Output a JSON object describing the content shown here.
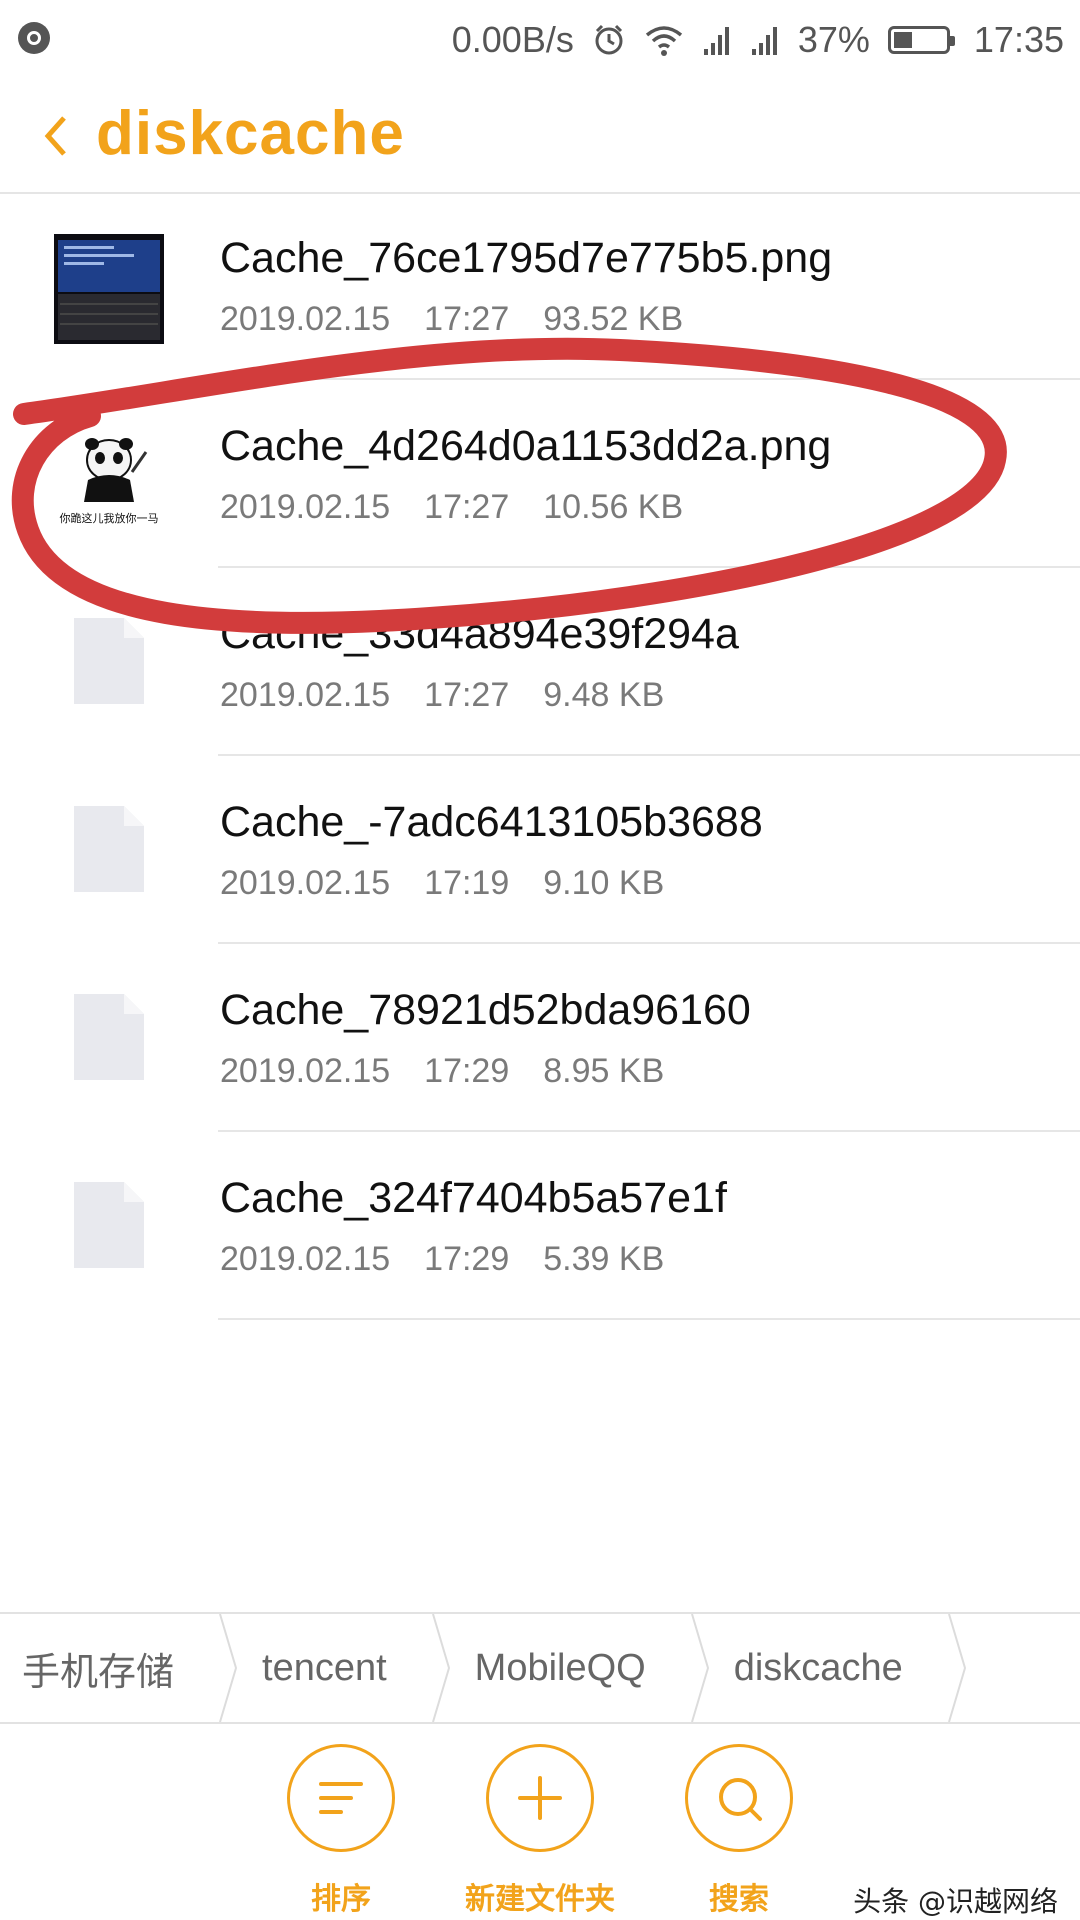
{
  "status_bar": {
    "net_speed": "0.00B/s",
    "battery_percent": "37%",
    "battery_level": 0.37,
    "time": "17:35",
    "icons": [
      "browser-icon",
      "alarm-icon",
      "wifi-icon",
      "signal-icon",
      "signal-icon",
      "battery-icon"
    ]
  },
  "header": {
    "title": "diskcache"
  },
  "files": [
    {
      "name": "Cache_76ce1795d7e775b5.png",
      "date": "2019.02.15",
      "time": "17:27",
      "size": "93.52 KB",
      "thumb": "laptop-screen"
    },
    {
      "name": "Cache_4d264d0a1153dd2a.png",
      "date": "2019.02.15",
      "time": "17:27",
      "size": "10.56 KB",
      "thumb": "panda-meme",
      "thumb_caption": "你跪这儿我放你一马"
    },
    {
      "name": "Cache_33d4a894e39f294a",
      "date": "2019.02.15",
      "time": "17:27",
      "size": "9.48 KB",
      "thumb": "doc"
    },
    {
      "name": "Cache_-7adc6413105b3688",
      "date": "2019.02.15",
      "time": "17:19",
      "size": "9.10 KB",
      "thumb": "doc"
    },
    {
      "name": "Cache_78921d52bda96160",
      "date": "2019.02.15",
      "time": "17:29",
      "size": "8.95 KB",
      "thumb": "doc"
    },
    {
      "name": "Cache_324f7404b5a57e1f",
      "date": "2019.02.15",
      "time": "17:29",
      "size": "5.39 KB",
      "thumb": "doc"
    }
  ],
  "breadcrumb": [
    "手机存储",
    "tencent",
    "MobileQQ",
    "diskcache"
  ],
  "toolbar": {
    "sort_label": "排序",
    "new_folder_label": "新建文件夹",
    "search_label": "搜索"
  },
  "watermark": "头条 @识越网络",
  "colors": {
    "accent": "#f2a31b",
    "annotation": "#d23c3c"
  }
}
